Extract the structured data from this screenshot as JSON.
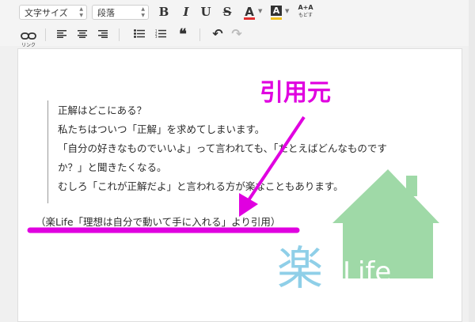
{
  "toolbar": {
    "font_size_select": "文字サイズ",
    "paragraph_select": "段落",
    "bold": "B",
    "italic": "I",
    "underline": "U",
    "strike": "S",
    "text_color": "A",
    "bg_color": "A",
    "font_size_toggle_top": "A+A",
    "font_size_toggle_bottom": "もどす",
    "link_label": "リンク",
    "quote": "❝",
    "undo": "↶",
    "redo": "↷"
  },
  "colors": {
    "accent_magenta": "#e000e0",
    "logo_green": "#9fd9a7",
    "logo_blue": "#8fcfe8",
    "text_color_red": "#e03030",
    "bg_color_yellow": "#f0c020"
  },
  "icons": [
    "chain-link-icon",
    "align-left-icon",
    "align-center-icon",
    "align-right-icon",
    "bullet-list-icon",
    "numbered-list-icon",
    "blockquote-icon",
    "undo-icon",
    "redo-icon"
  ],
  "quote": {
    "lines": [
      "正解はどこにある？",
      "私たちはついつ「正解」を求めてしまいます。",
      "「自分の好きなものでいいよ」って言われても、「たとえばどんなものです",
      "か？」と聞きたくなる。",
      "むしろ「これが正解だよ」と言われる方が楽なこともあります。"
    ]
  },
  "citation": "（楽Life「理想は自分で動いて手に入れる」より引用）",
  "annotation": "引用元",
  "logo": {
    "kanji": "楽",
    "word": "Life"
  }
}
